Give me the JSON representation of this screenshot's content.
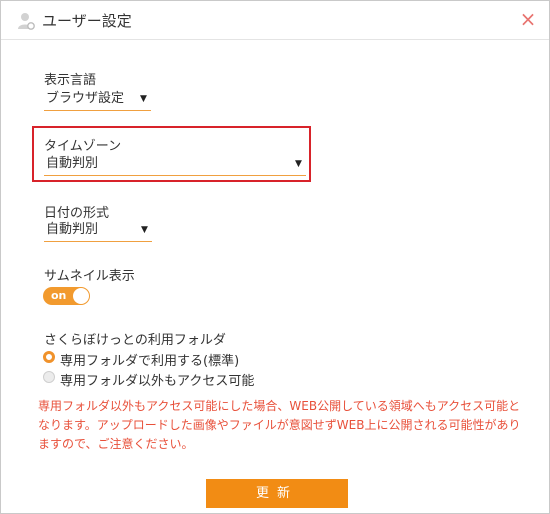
{
  "dialog": {
    "title": "ユーザー設定",
    "close_label": "×"
  },
  "language": {
    "label": "表示言語",
    "value": "ブラウザ設定"
  },
  "timezone": {
    "label": "タイムゾーン",
    "value": "自動判別"
  },
  "date_format": {
    "label": "日付の形式",
    "value": "自動判別"
  },
  "thumbnail": {
    "label": "サムネイル表示",
    "toggle_text": "on"
  },
  "folder": {
    "label": "さくらぼけっとの利用フォルダ",
    "options": [
      {
        "label": "専用フォルダで利用する(標準)",
        "selected": true
      },
      {
        "label": "専用フォルダ以外もアクセス可能",
        "selected": false
      }
    ]
  },
  "warning_text": "専用フォルダ以外もアクセス可能にした場合、WEB公開している領域へもアクセス可能となります。アップロードした画像やファイルが意図せずWEB上に公開される可能性がありますので、ご注意ください。",
  "submit_label": "更新",
  "icons": {
    "user": "user-settings-icon",
    "close": "close-icon",
    "dropdown": "chevron-down-icon"
  },
  "colors": {
    "accent": "#f28c14",
    "highlight_border": "#d8232a",
    "warning_text": "#e8503a",
    "close": "#e8736f"
  }
}
